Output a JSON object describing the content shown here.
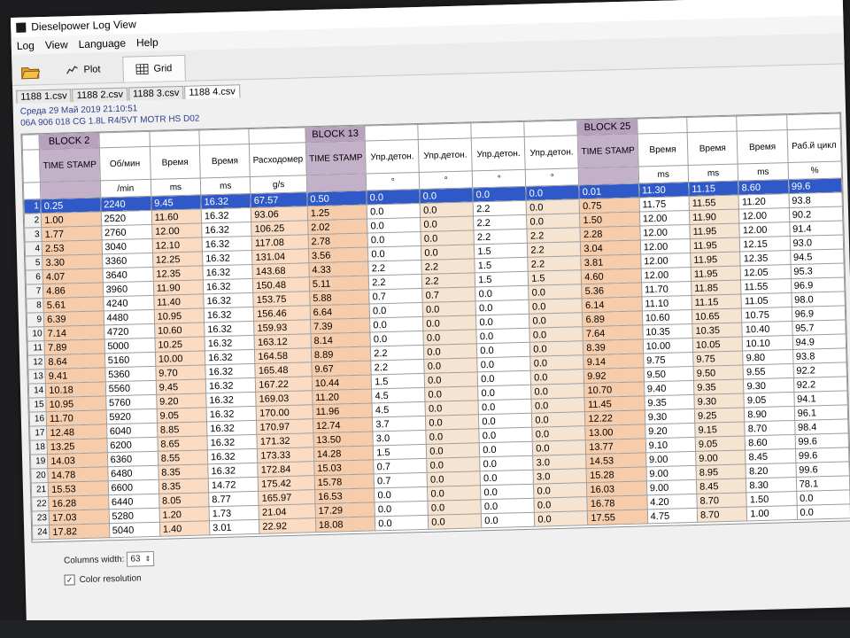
{
  "window": {
    "title": "Dieselpower Log View"
  },
  "menu": [
    "Log",
    "View",
    "Language",
    "Help"
  ],
  "toolbar": {
    "plot_label": "Plot",
    "grid_label": "Grid"
  },
  "file_tabs": [
    "1188 1.csv",
    "1188 2.csv",
    "1188 3.csv",
    "1188 4.csv"
  ],
  "active_tab": 3,
  "info": {
    "date": "Среда 29 Май 2019 21:10:51",
    "engine": "06A 906 018 CG  1.8L R4/5VT MOTR HS D02"
  },
  "blocks": [
    {
      "name": "BLOCK 2",
      "cols": 5
    },
    {
      "name": "BLOCK 13",
      "cols": 5
    },
    {
      "name": "BLOCK 25",
      "cols": 5
    }
  ],
  "columns": [
    {
      "name": "TIME STAMP",
      "unit": "",
      "style": "ts"
    },
    {
      "name": "Об/мин",
      "unit": "/min",
      "style": "a"
    },
    {
      "name": "Время",
      "unit": "ms",
      "style": "w"
    },
    {
      "name": "Время",
      "unit": "ms",
      "style": "a"
    },
    {
      "name": "Расходомер",
      "unit": "g/s",
      "style": "w"
    },
    {
      "name": "TIME STAMP",
      "unit": "",
      "style": "ts"
    },
    {
      "name": "Упр.детон.",
      "unit": "°",
      "style": "a"
    },
    {
      "name": "Упр.детон.",
      "unit": "°",
      "style": "b"
    },
    {
      "name": "Упр.детон.",
      "unit": "°",
      "style": "a"
    },
    {
      "name": "Упр.детон.",
      "unit": "°",
      "style": "b"
    },
    {
      "name": "TIME STAMP",
      "unit": "",
      "style": "ts"
    },
    {
      "name": "Время",
      "unit": "ms",
      "style": "a"
    },
    {
      "name": "Время",
      "unit": "ms",
      "style": "b"
    },
    {
      "name": "Время",
      "unit": "ms",
      "style": "a"
    },
    {
      "name": "Раб.й цикл",
      "unit": "%",
      "style": "y"
    }
  ],
  "rows": [
    {
      "n": "1",
      "cells": [
        "0.25",
        "2240",
        "9.45",
        "16.32",
        "67.57",
        "0.50",
        "0.0",
        "0.0",
        "0.0",
        "0.0",
        "0.01",
        "11.30",
        "11.15",
        "8.60",
        "99.6"
      ],
      "selected": true
    },
    {
      "n": "2",
      "cells": [
        "1.00",
        "2520",
        "11.60",
        "16.32",
        "93.06",
        "1.25",
        "0.0",
        "0.0",
        "2.2",
        "0.0",
        "0.75",
        "11.75",
        "11.55",
        "11.20",
        "93.8"
      ]
    },
    {
      "n": "3",
      "cells": [
        "1.77",
        "2760",
        "12.00",
        "16.32",
        "106.25",
        "2.02",
        "0.0",
        "0.0",
        "2.2",
        "0.0",
        "1.50",
        "12.00",
        "11.90",
        "12.00",
        "90.2"
      ]
    },
    {
      "n": "4",
      "cells": [
        "2.53",
        "3040",
        "12.10",
        "16.32",
        "117.08",
        "2.78",
        "0.0",
        "0.0",
        "2.2",
        "2.2",
        "2.28",
        "12.00",
        "11.95",
        "12.00",
        "91.4"
      ]
    },
    {
      "n": "5",
      "cells": [
        "3.30",
        "3360",
        "12.25",
        "16.32",
        "131.04",
        "3.56",
        "0.0",
        "0.0",
        "1.5",
        "2.2",
        "3.04",
        "12.00",
        "11.95",
        "12.15",
        "93.0"
      ]
    },
    {
      "n": "6",
      "cells": [
        "4.07",
        "3640",
        "12.35",
        "16.32",
        "143.68",
        "4.33",
        "2.2",
        "2.2",
        "1.5",
        "2.2",
        "3.81",
        "12.00",
        "11.95",
        "12.35",
        "94.5"
      ]
    },
    {
      "n": "7",
      "cells": [
        "4.86",
        "3960",
        "11.90",
        "16.32",
        "150.48",
        "5.11",
        "2.2",
        "2.2",
        "1.5",
        "1.5",
        "4.60",
        "12.00",
        "11.95",
        "12.05",
        "95.3"
      ]
    },
    {
      "n": "8",
      "cells": [
        "5.61",
        "4240",
        "11.40",
        "16.32",
        "153.75",
        "5.88",
        "0.7",
        "0.7",
        "0.0",
        "0.0",
        "5.36",
        "11.70",
        "11.85",
        "11.55",
        "96.9"
      ]
    },
    {
      "n": "9",
      "cells": [
        "6.39",
        "4480",
        "10.95",
        "16.32",
        "156.46",
        "6.64",
        "0.0",
        "0.0",
        "0.0",
        "0.0",
        "6.14",
        "11.10",
        "11.15",
        "11.05",
        "98.0"
      ]
    },
    {
      "n": "10",
      "cells": [
        "7.14",
        "4720",
        "10.60",
        "16.32",
        "159.93",
        "7.39",
        "0.0",
        "0.0",
        "0.0",
        "0.0",
        "6.89",
        "10.60",
        "10.65",
        "10.75",
        "96.9"
      ]
    },
    {
      "n": "11",
      "cells": [
        "7.89",
        "5000",
        "10.25",
        "16.32",
        "163.12",
        "8.14",
        "0.0",
        "0.0",
        "0.0",
        "0.0",
        "7.64",
        "10.35",
        "10.35",
        "10.40",
        "95.7"
      ]
    },
    {
      "n": "12",
      "cells": [
        "8.64",
        "5160",
        "10.00",
        "16.32",
        "164.58",
        "8.89",
        "2.2",
        "0.0",
        "0.0",
        "0.0",
        "8.39",
        "10.00",
        "10.05",
        "10.10",
        "94.9"
      ]
    },
    {
      "n": "13",
      "cells": [
        "9.41",
        "5360",
        "9.70",
        "16.32",
        "165.48",
        "9.67",
        "2.2",
        "0.0",
        "0.0",
        "0.0",
        "9.14",
        "9.75",
        "9.75",
        "9.80",
        "93.8"
      ]
    },
    {
      "n": "14",
      "cells": [
        "10.18",
        "5560",
        "9.45",
        "16.32",
        "167.22",
        "10.44",
        "1.5",
        "0.0",
        "0.0",
        "0.0",
        "9.92",
        "9.50",
        "9.50",
        "9.55",
        "92.2"
      ]
    },
    {
      "n": "15",
      "cells": [
        "10.95",
        "5760",
        "9.20",
        "16.32",
        "169.03",
        "11.20",
        "4.5",
        "0.0",
        "0.0",
        "0.0",
        "10.70",
        "9.40",
        "9.35",
        "9.30",
        "92.2"
      ]
    },
    {
      "n": "16",
      "cells": [
        "11.70",
        "5920",
        "9.05",
        "16.32",
        "170.00",
        "11.96",
        "4.5",
        "0.0",
        "0.0",
        "0.0",
        "11.45",
        "9.35",
        "9.30",
        "9.05",
        "94.1"
      ]
    },
    {
      "n": "17",
      "cells": [
        "12.48",
        "6040",
        "8.85",
        "16.32",
        "170.97",
        "12.74",
        "3.7",
        "0.0",
        "0.0",
        "0.0",
        "12.22",
        "9.30",
        "9.25",
        "8.90",
        "96.1"
      ]
    },
    {
      "n": "18",
      "cells": [
        "13.25",
        "6200",
        "8.65",
        "16.32",
        "171.32",
        "13.50",
        "3.0",
        "0.0",
        "0.0",
        "0.0",
        "13.00",
        "9.20",
        "9.15",
        "8.70",
        "98.4"
      ]
    },
    {
      "n": "19",
      "cells": [
        "14.03",
        "6360",
        "8.55",
        "16.32",
        "173.33",
        "14.28",
        "1.5",
        "0.0",
        "0.0",
        "0.0",
        "13.77",
        "9.10",
        "9.05",
        "8.60",
        "99.6"
      ]
    },
    {
      "n": "20",
      "cells": [
        "14.78",
        "6480",
        "8.35",
        "16.32",
        "172.84",
        "15.03",
        "0.7",
        "0.0",
        "0.0",
        "3.0",
        "14.53",
        "9.00",
        "9.00",
        "8.45",
        "99.6"
      ]
    },
    {
      "n": "21",
      "cells": [
        "15.53",
        "6600",
        "8.35",
        "14.72",
        "175.42",
        "15.78",
        "0.7",
        "0.0",
        "0.0",
        "3.0",
        "15.28",
        "9.00",
        "8.95",
        "8.20",
        "99.6"
      ]
    },
    {
      "n": "22",
      "cells": [
        "16.28",
        "6440",
        "8.05",
        "8.77",
        "165.97",
        "16.53",
        "0.0",
        "0.0",
        "0.0",
        "0.0",
        "16.03",
        "9.00",
        "8.45",
        "8.30",
        "78.1"
      ]
    },
    {
      "n": "23",
      "cells": [
        "17.03",
        "5280",
        "1.20",
        "1.73",
        "21.04",
        "17.29",
        "0.0",
        "0.0",
        "0.0",
        "0.0",
        "16.78",
        "4.20",
        "8.70",
        "1.50",
        "0.0"
      ]
    },
    {
      "n": "24",
      "cells": [
        "17.82",
        "5040",
        "1.40",
        "3.01",
        "22.92",
        "18.08",
        "0.0",
        "0.0",
        "0.0",
        "0.0",
        "17.55",
        "4.75",
        "8.70",
        "1.00",
        "0.0"
      ]
    }
  ],
  "footer": {
    "columns_width_label": "Columns width:",
    "columns_width_value": "63",
    "color_resolution_label": "Color resolution",
    "color_resolution_checked": "✓"
  }
}
